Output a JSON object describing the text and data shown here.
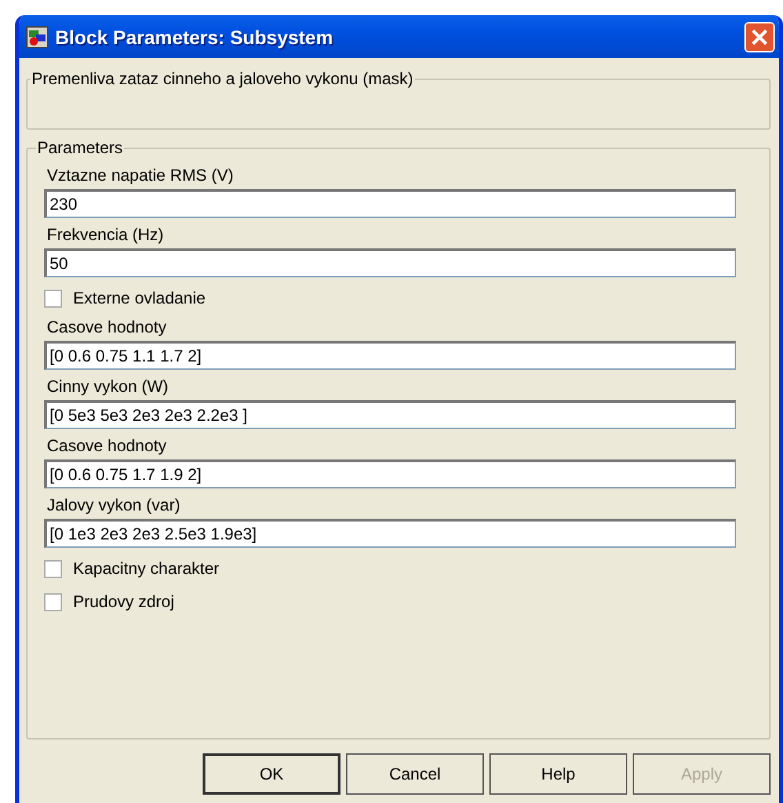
{
  "window": {
    "title": "Block Parameters: Subsystem"
  },
  "description": {
    "title": "Premenliva zataz cinneho a jaloveho vykonu (mask)"
  },
  "parameters": {
    "title": "Parameters",
    "items": [
      {
        "kind": "edit",
        "label": "Vztazne napatie RMS (V)",
        "value": "230"
      },
      {
        "kind": "edit",
        "label": "Frekvencia (Hz)",
        "value": "50"
      },
      {
        "kind": "checkbox",
        "label": "Externe ovladanie",
        "checked": false
      },
      {
        "kind": "edit",
        "label": "Casove hodnoty",
        "value": "[0 0.6 0.75 1.1 1.7 2]"
      },
      {
        "kind": "edit",
        "label": "Cinny vykon (W)",
        "value": "[0 5e3 5e3 2e3 2e3 2.2e3 ]"
      },
      {
        "kind": "edit",
        "label": "Casove hodnoty",
        "value": "[0 0.6 0.75 1.7 1.9 2]"
      },
      {
        "kind": "edit",
        "label": "Jalovy vykon (var)",
        "value": "[0 1e3 2e3 2e3 2.5e3 1.9e3]"
      },
      {
        "kind": "checkbox",
        "label": "Kapacitny charakter",
        "checked": false
      },
      {
        "kind": "checkbox",
        "label": "Prudovy zdroj",
        "checked": false
      }
    ]
  },
  "buttons": [
    {
      "label": "OK",
      "disabled": false
    },
    {
      "label": "Cancel",
      "disabled": false
    },
    {
      "label": "Help",
      "disabled": false
    },
    {
      "label": "Apply",
      "disabled": true
    }
  ]
}
